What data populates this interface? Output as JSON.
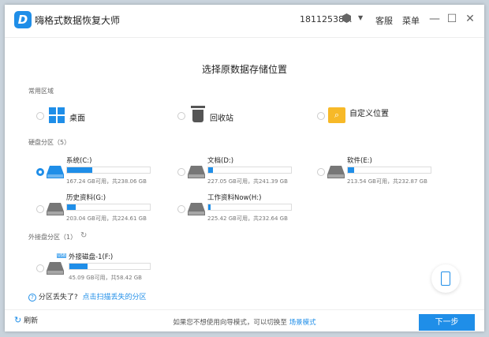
{
  "app": {
    "title": "嗨格式数据恢复大师",
    "account": "18112538...",
    "support": "客服",
    "menu": "菜单"
  },
  "heading": "选择原数据存储位置",
  "common": {
    "label": "常用区域",
    "items": [
      {
        "label": "桌面",
        "icon": "windows-icon"
      },
      {
        "label": "回收站",
        "icon": "recycle-bin-icon"
      },
      {
        "label": "自定义位置",
        "icon": "folder-search-icon"
      }
    ]
  },
  "disks": {
    "label": "硬盘分区（5）",
    "items": [
      {
        "name": "系统(C:)",
        "size": "167.24 GB可用，共238.06 GB",
        "used_fraction": 0.3,
        "selected": true
      },
      {
        "name": "文档(D:)",
        "size": "227.05 GB可用，共241.39 GB",
        "used_fraction": 0.06,
        "selected": false
      },
      {
        "name": "软件(E:)",
        "size": "213.54 GB可用，共232.87 GB",
        "used_fraction": 0.08,
        "selected": false
      },
      {
        "name": "历史资料(G:)",
        "size": "203.04 GB可用，共224.61 GB",
        "used_fraction": 0.1,
        "selected": false
      },
      {
        "name": "工作资料Now(H:)",
        "size": "225.42 GB可用，共232.64 GB",
        "used_fraction": 0.03,
        "selected": false
      }
    ]
  },
  "external": {
    "label": "外接盘分区（1）",
    "items": [
      {
        "name": "外接磁盘-1(F:)",
        "badge": "USB",
        "size": "45.09 GB可用，共58.42 GB",
        "used_fraction": 0.23,
        "selected": false
      }
    ]
  },
  "lost": {
    "question": "分区丢失了?",
    "link": "点击扫描丢失的分区"
  },
  "footer": {
    "refresh": "刷新",
    "hint": "如果您不想使用向导模式，可以切换至",
    "mode_link": "场景模式",
    "next": "下一步"
  },
  "colors": {
    "accent": "#1f8ee8"
  }
}
